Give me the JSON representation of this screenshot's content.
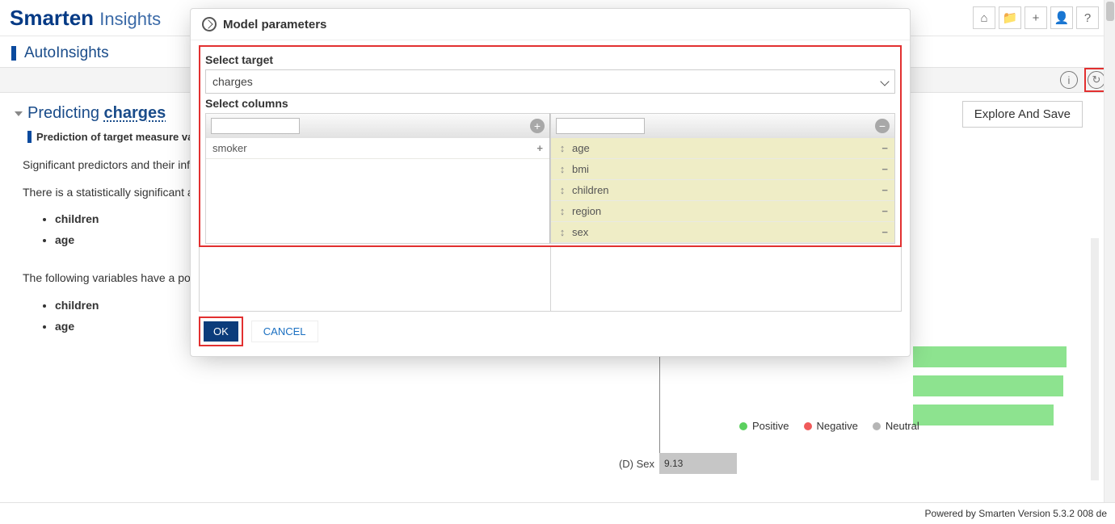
{
  "brand": {
    "main": "Smarten",
    "sub": "Insights"
  },
  "subhead": "AutoInsights",
  "icons": {
    "home": "home-icon",
    "folder": "folder-icon",
    "plus": "plus-icon",
    "user": "user-icon",
    "help": "help-icon",
    "info": "info-icon",
    "refresh": "refresh-icon"
  },
  "predicting": {
    "prefix": "Predicting",
    "target": "charges",
    "subline": "Prediction of target measure var",
    "p1": "Significant predictors and their influe",
    "p2": "There is a statistically significant as",
    "list1": [
      "children",
      "age"
    ],
    "p3": "The following variables have a posit",
    "list2": [
      "children",
      "age"
    ]
  },
  "explore_btn": "Explore And Save",
  "chart_stub": {
    "row_label": "(D) Sex",
    "row_value": "9.13"
  },
  "legend": {
    "positive": "Positive",
    "negative": "Negative",
    "neutral": "Neutral"
  },
  "footer": "Powered by Smarten Version 5.3.2 008 de",
  "dialog": {
    "title": "Model parameters",
    "select_target_label": "Select target",
    "target_value": "charges",
    "select_columns_label": "Select columns",
    "available": [
      {
        "name": "smoker"
      }
    ],
    "selected": [
      {
        "name": "age"
      },
      {
        "name": "bmi"
      },
      {
        "name": "children"
      },
      {
        "name": "region"
      },
      {
        "name": "sex"
      }
    ],
    "ok": "OK",
    "cancel": "CANCEL"
  }
}
